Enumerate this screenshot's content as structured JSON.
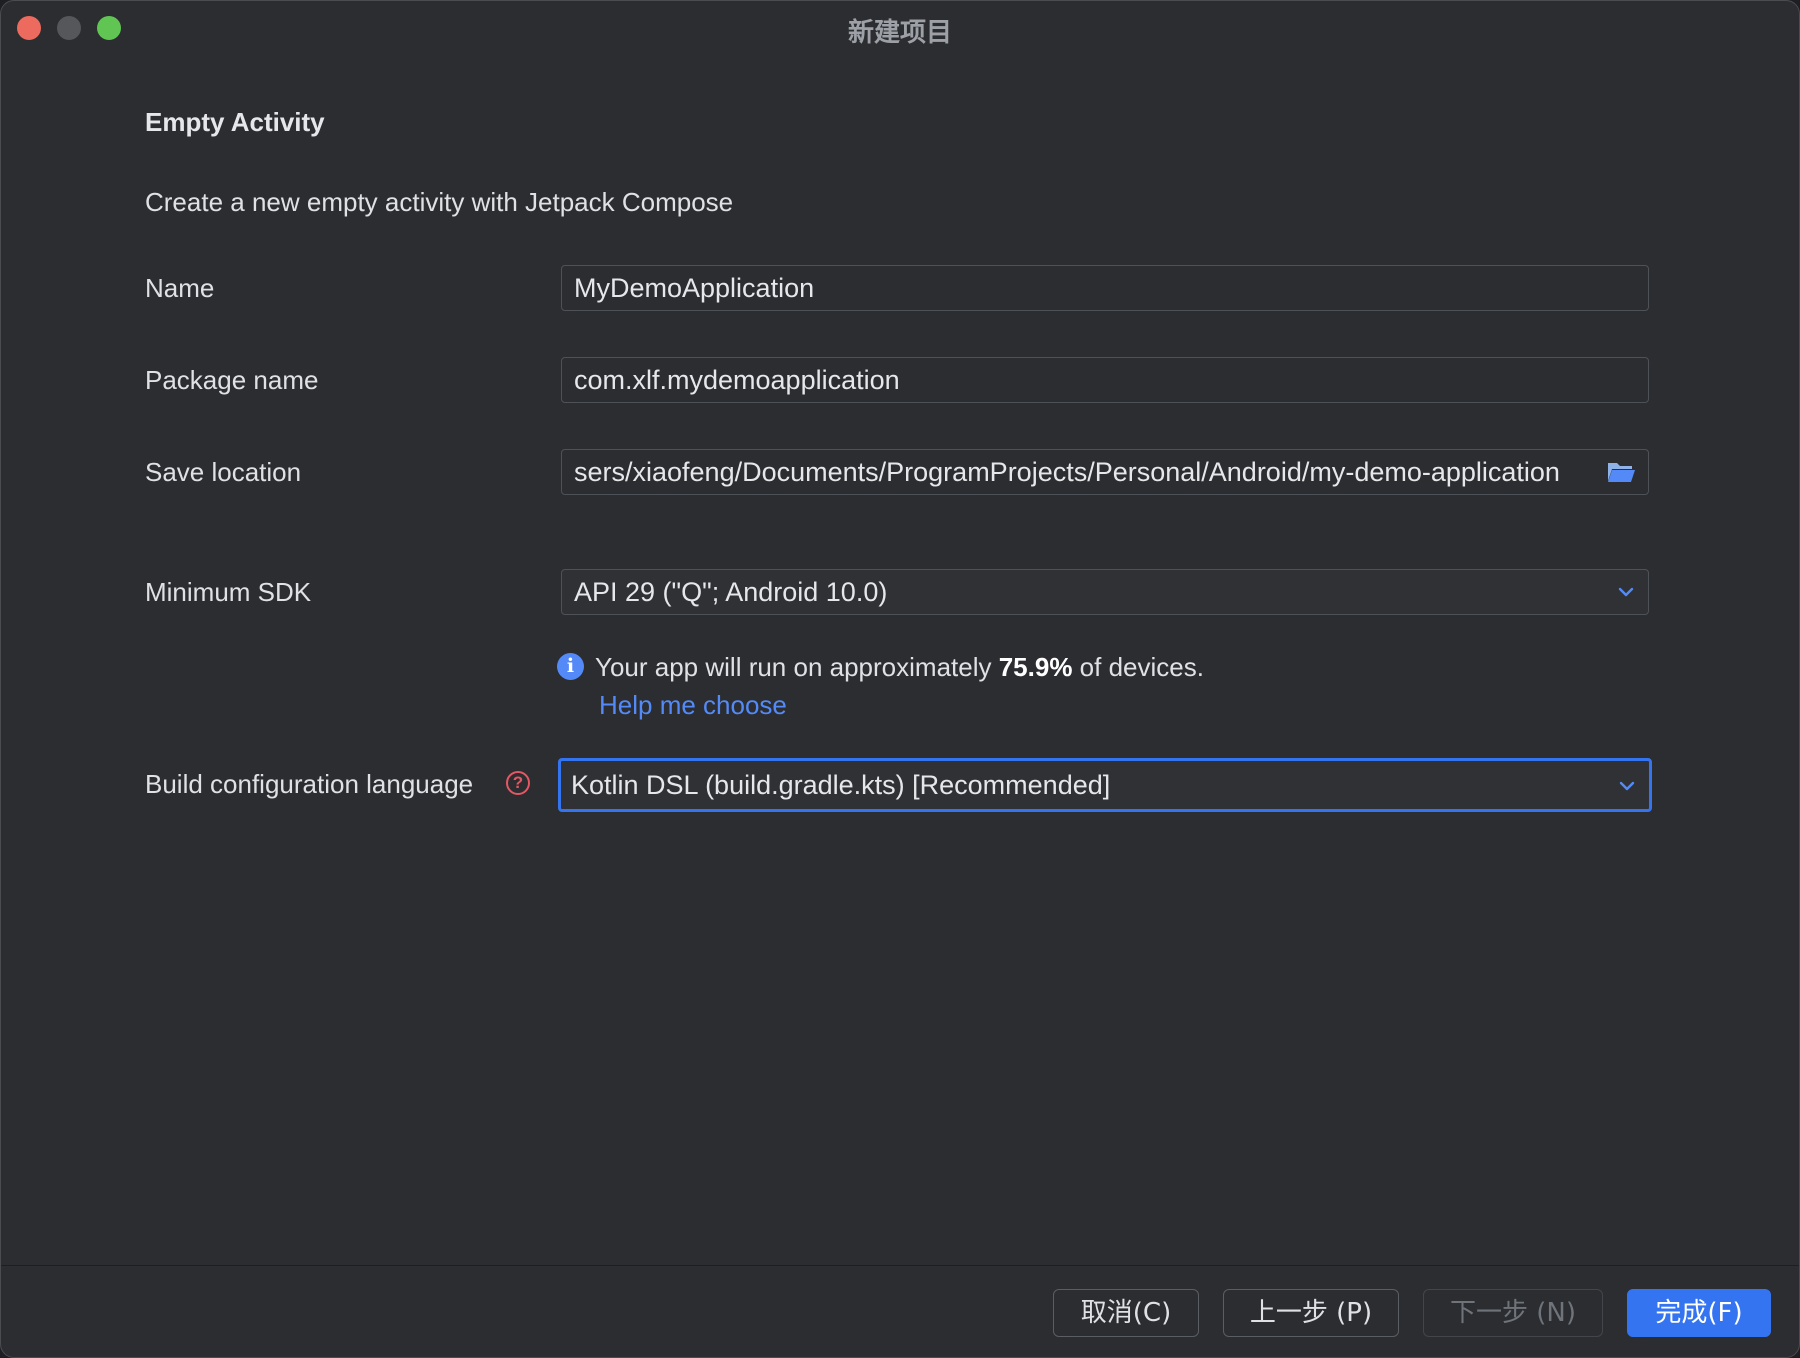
{
  "window": {
    "title": "新建项目"
  },
  "page": {
    "heading": "Empty Activity",
    "description": "Create a new empty activity with Jetpack Compose"
  },
  "form": {
    "name": {
      "label": "Name",
      "value": "MyDemoApplication"
    },
    "package": {
      "label": "Package name",
      "value": "com.xlf.mydemoapplication"
    },
    "location": {
      "label": "Save location",
      "value": "sers/xiaofeng/Documents/ProgramProjects/Personal/Android/my-demo-application"
    },
    "min_sdk": {
      "label": "Minimum SDK",
      "value": "API 29 (\"Q\"; Android 10.0)"
    },
    "sdk_info": {
      "prefix": "Your app will run on approximately ",
      "percent": "75.9%",
      "suffix": " of devices.",
      "link": "Help me choose"
    },
    "build_lang": {
      "label": "Build configuration language",
      "value": "Kotlin DSL (build.gradle.kts) [Recommended]"
    }
  },
  "footer": {
    "cancel": "取消(C)",
    "previous": "上一步 (P)",
    "next": "下一步 (N)",
    "finish": "完成(F)"
  },
  "colors": {
    "accent": "#3574f0",
    "link": "#548af7",
    "help": "#e55765"
  },
  "icons": [
    "info-icon",
    "help-icon",
    "folder-icon",
    "chevron-down-icon"
  ]
}
